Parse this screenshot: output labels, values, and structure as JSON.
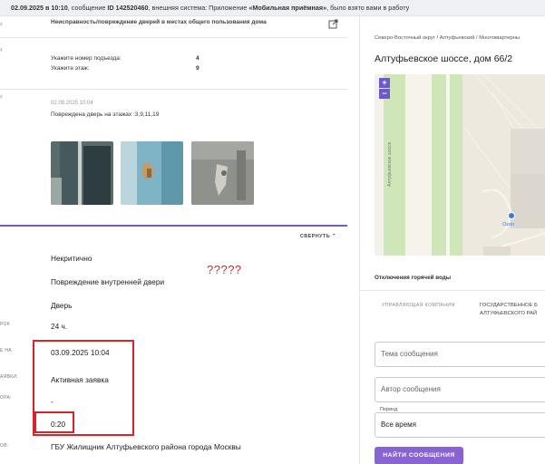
{
  "notice": {
    "date_time": "02.09.2025 в 10:10",
    "text_1": ", сообщение ",
    "id_label": "ID 142520460",
    "text_2": ", внешняя система: Приложение ",
    "system": "«Мобильная приёмная»",
    "text_3": ", было взято вами в работу"
  },
  "card": {
    "header_text": "Неисправность/повреждение дверей в местах общего пользования дома",
    "fields": [
      {
        "label": "Укажите номер подъезда:",
        "value": "4"
      },
      {
        "label": "Укажите этаж:",
        "value": "9"
      }
    ],
    "message_time": "02.09.2025 10:04",
    "message_text": "Повреждена дверь на этажах :3,9,11,19",
    "photos": [
      "photo-1",
      "photo-2",
      "photo-3"
    ]
  },
  "details": {
    "collapse_label": "СВЕРНУТЬ",
    "annotation": "?????",
    "rows": [
      {
        "label": "",
        "value": "Некритично"
      },
      {
        "label": "",
        "value": "Повреждение внутренней двери"
      },
      {
        "label": "",
        "value": "Дверь"
      },
      {
        "label": "РОК",
        "value": "24 ч."
      },
      {
        "label": "Е НА",
        "value": "03.09.2025 10:04"
      },
      {
        "label": "АЯВКИ:",
        "value": "Активная заявка"
      },
      {
        "label": "ОРА:",
        "value": "-"
      },
      {
        "label": "",
        "value": "0:20"
      },
      {
        "label": "ОВ:",
        "value": "ГБУ Жилищник Алтуфьевского района города Москвы"
      }
    ]
  },
  "sidebar": {
    "breadcrumb": "Северо-Восточный округ / Алтуфьевский / Многоквартирны",
    "address": "Алтуфьевское шоссе, дом 66/2",
    "map": {
      "street_label": "Алтуфьевское шоссе",
      "poi_label": "Ozon",
      "zoom_in": "+",
      "zoom_out": "−"
    },
    "section_title": "Отключения горячей воды",
    "company_label": "УПРАВЛЯЮЩАЯ КОМПАНИЯ",
    "company_value_1": "ГОСУДАРСТВЕННОЕ Б",
    "company_value_2": "АЛТУФЬЕВСКОГО РАЙ",
    "topic_placeholder": "Тема сообщения",
    "author_placeholder": "Автор сообщения",
    "period_legend": "Период",
    "period_value": "Все время",
    "find_button": "НАЙТИ СООБЩЕНИЯ"
  },
  "colors": {
    "accent": "#8a63d2",
    "highlight": "#d8232a"
  }
}
